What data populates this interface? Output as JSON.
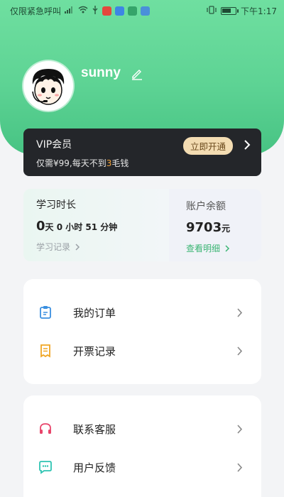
{
  "status_bar": {
    "carrier": "仅限紧急呼叫",
    "time": "下午1:17"
  },
  "profile": {
    "username": "sunny"
  },
  "vip": {
    "title": "VIP会员",
    "subtitle_prefix": "仅需¥99,每天不到",
    "subtitle_highlight": "3",
    "subtitle_suffix": "毛钱",
    "button_label": "立即开通"
  },
  "study": {
    "label": "学习时长",
    "days": "0",
    "days_unit": "天",
    "rest": " 0 小时 51 分钟",
    "link": "学习记录"
  },
  "balance": {
    "label": "账户余额",
    "amount": "9703",
    "unit": "元",
    "link": "查看明细"
  },
  "menu_group_1": [
    {
      "label": "我的订单",
      "icon": "order-icon",
      "color": "#3a8fe0"
    },
    {
      "label": "开票记录",
      "icon": "invoice-icon",
      "color": "#f0a623"
    }
  ],
  "menu_group_2": [
    {
      "label": "联系客服",
      "icon": "headset-icon",
      "color": "#e8456b"
    },
    {
      "label": "用户反馈",
      "icon": "feedback-icon",
      "color": "#2fc4b2"
    }
  ],
  "colors": {
    "header_green": "#5dd394",
    "vip_dark": "#24262a",
    "vip_gold": "#f3dcb2",
    "link_green": "#3cb574"
  }
}
